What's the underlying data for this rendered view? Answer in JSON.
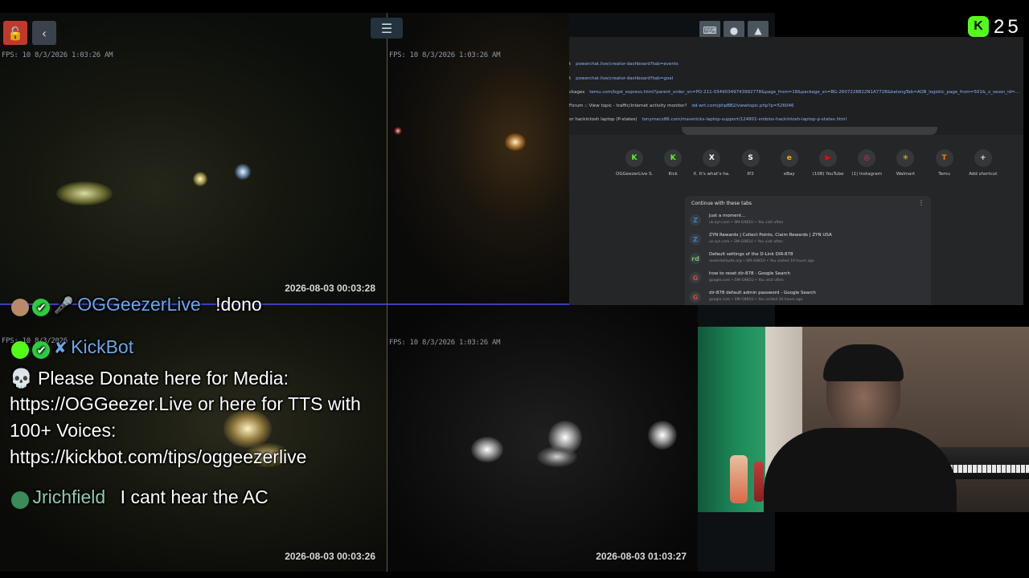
{
  "cameras": [
    {
      "fps": "FPS: 10 8/3/2026 1:03:26 AM",
      "timestamp": "2026-08-03  00:03:28"
    },
    {
      "fps": "FPS: 10 8/3/2026 1:03:26 AM",
      "timestamp": ""
    },
    {
      "fps": "FPS: 10 8/3/2026",
      "timestamp": "2026-08-03  00:03:26"
    },
    {
      "fps": "FPS: 10 8/3/2026 1:03:26 AM",
      "timestamp": "2026-08-03  01:03:27"
    }
  ],
  "viewer_count": "25",
  "history": [
    {
      "title": "t",
      "url": "powerchat.live/creator-dashboard?tab=events"
    },
    {
      "title": "t",
      "url": "powerchat.live/creator-dashboard?tab=goal"
    },
    {
      "title": "ckages",
      "url": "temu.com/bgst_express.html?parent_order_sn=PO-211-03490349743992778&page_from=18&package_sn=BG-2607228822N1A7728&belongTab=AOB_logistic_page_from=501&_x_sessn_id=..."
    },
    {
      "title": "Forum :: View topic - traffic/internet activity monitor?",
      "url": "dd-wrt.com/phpBB2/viewtopic.php?p=526046"
    },
    {
      "title": "or hackintosh laptop (P-states)",
      "url": "tonymacx86.com/mavericks-laptop-support/124801-smbios-hackintosh-laptop-p-states.html"
    }
  ],
  "shortcuts": [
    {
      "label": "OGGeezerLive S...",
      "icon": "K",
      "color": "#53fc18"
    },
    {
      "label": "Kick",
      "icon": "K",
      "color": "#53fc18"
    },
    {
      "label": "X. It's what's ha...",
      "icon": "X",
      "color": "#ffffff"
    },
    {
      "label": "IP2",
      "icon": "S",
      "color": "#ffffff"
    },
    {
      "label": "eBay",
      "icon": "e",
      "color": "#f5af02"
    },
    {
      "label": "(108) YouTube",
      "icon": "▶",
      "color": "#ff0000"
    },
    {
      "label": "(1) Instagram",
      "icon": "◎",
      "color": "#e1306c"
    },
    {
      "label": "Walmart",
      "icon": "✳",
      "color": "#ffc220"
    },
    {
      "label": "Temu",
      "icon": "T",
      "color": "#fb7701"
    },
    {
      "label": "Add shortcut",
      "icon": "+",
      "color": "#e2e4e7"
    }
  ],
  "tabs_card": {
    "title": "Continue with these tabs",
    "items": [
      {
        "title": "Just a moment...",
        "sub": "uk.zyn.com • SM-G981U • You visit often",
        "icon": "Z",
        "color": "#2b8ad6"
      },
      {
        "title": "ZYN Rewards | Collect Points, Claim Rewards | ZYN USA",
        "sub": "us.zyn.com • SM-G981U • You visit often",
        "icon": "Z",
        "color": "#2b8ad6"
      },
      {
        "title": "Default settings of the D-Link DIR-878",
        "sub": "routerdefaults.org • SM-G981U • You visited 10 hours ago",
        "icon": "rd",
        "color": "#6fbf73"
      },
      {
        "title": "how to reset dir-878 - Google Search",
        "sub": "google.com • SM-G981U • You visit often",
        "icon": "G",
        "color": "#ea4335"
      },
      {
        "title": "dir-878 default admin password - Google Search",
        "sub": "google.com • SM-G981U • You visited 20 hours ago",
        "icon": "G",
        "color": "#ea4335"
      }
    ]
  },
  "chat": {
    "messages": [
      {
        "username": "OGGeezerLive",
        "user_color": "#6aa7e8",
        "text": "!dono"
      },
      {
        "username": "KickBot",
        "user_color": "#6aa7e8",
        "text_lines": [
          "💀 Please Donate here for Media:",
          "https://OGGeezer.Live or here for TTS with",
          "100+ Voices:",
          "https://kickbot.com/tips/oggeezerlive"
        ]
      },
      {
        "username": "Jrichfield",
        "user_color": "#8ec9b0",
        "text": "I cant hear the AC"
      }
    ]
  }
}
